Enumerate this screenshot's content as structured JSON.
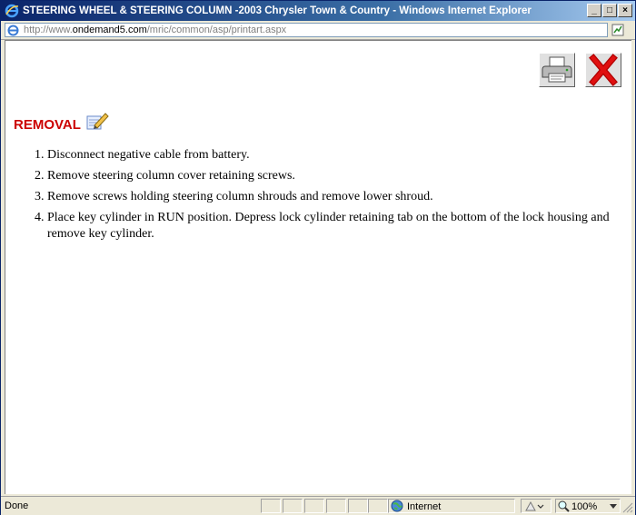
{
  "window": {
    "title": "STEERING WHEEL & STEERING COLUMN -2003 Chrysler Town & Country - Windows Internet Explorer",
    "minimize_label": "_",
    "maximize_label": "□",
    "close_label": "×"
  },
  "address": {
    "url_prefix": "http://www.",
    "url_domain": "ondemand5.com",
    "url_path": "/mric/common/asp/printart.aspx"
  },
  "page": {
    "heading": "REMOVAL",
    "steps": [
      "Disconnect negative cable from battery.",
      "Remove steering column cover retaining screws.",
      "Remove screws holding steering column shrouds and remove lower shroud.",
      "Place key cylinder in RUN position. Depress lock cylinder retaining tab on the bottom of the lock housing and remove key cylinder."
    ]
  },
  "status": {
    "text": "Done",
    "zone": "Internet",
    "zoom": "100%"
  },
  "icons": {
    "print": "printer-icon",
    "close_page": "red-x-icon",
    "edit": "notepad-pencil-icon",
    "ie": "ie-logo-icon",
    "globe": "globe-icon"
  },
  "colors": {
    "heading": "#cc0000",
    "titlebar": "#0a246a"
  }
}
